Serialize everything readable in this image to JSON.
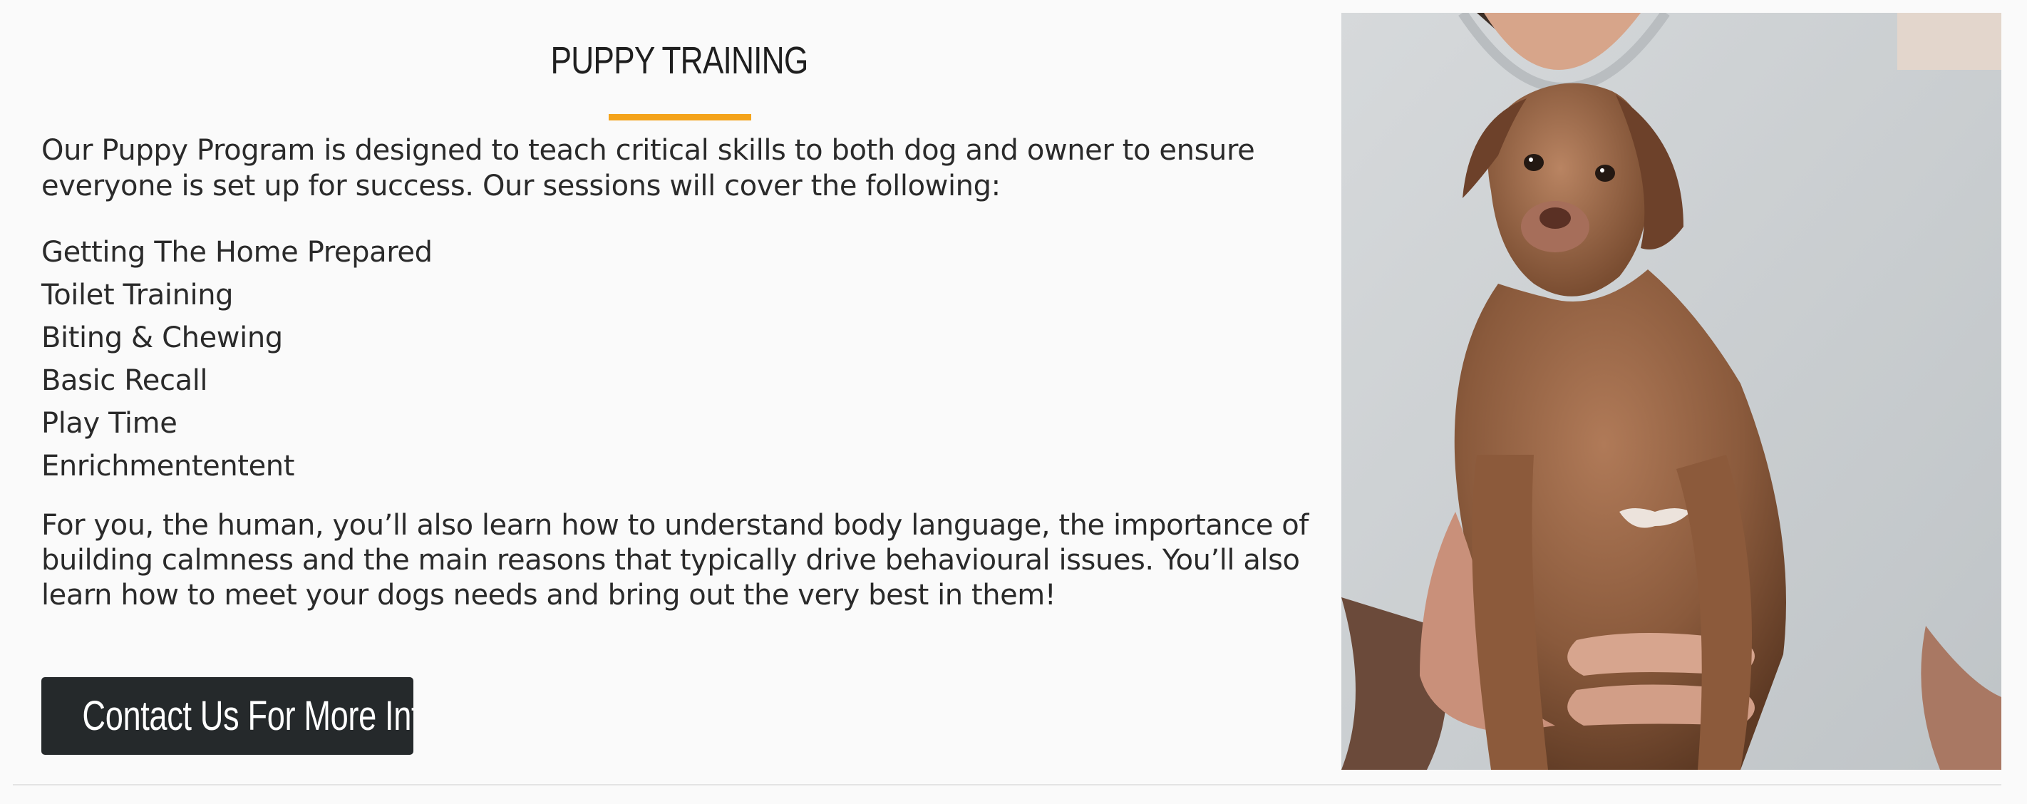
{
  "section": {
    "title": "PUPPY TRAINING",
    "intro": "Our Puppy Program is designed to teach critical skills to both dog and owner to ensure everyone is set up for success. Our sessions will cover the following:",
    "topics": [
      "Getting The Home Prepared",
      "Toilet Training",
      "Biting & Chewing",
      "Basic Recall",
      "Play Time",
      "Enrichmententent"
    ],
    "outro": "For you, the human, you’ll also learn how to understand body language, the importance of building calmness and the main reasons that typically drive behavioural issues. You’ll also learn how to meet your dogs needs and bring out the very best in them!",
    "cta_label": "Contact Us For More Info"
  },
  "colors": {
    "accent": "#f4a31a",
    "button_bg": "#25292b",
    "page_bg": "#fafafa"
  }
}
